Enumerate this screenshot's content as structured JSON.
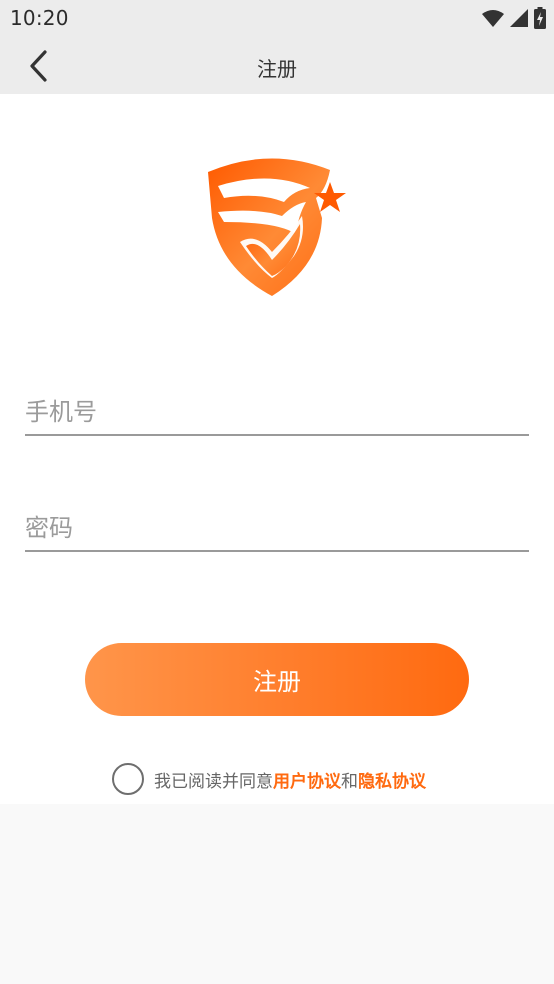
{
  "status_bar": {
    "time": "10:20",
    "icons": [
      "wifi-icon",
      "cellular-signal-icon",
      "battery-charging-icon"
    ]
  },
  "app_bar": {
    "title": "注册",
    "back_icon": "chevron-left-icon"
  },
  "logo": {
    "icon": "shield-star-logo",
    "color": "#ff7a1f"
  },
  "form": {
    "phone": {
      "value": "",
      "placeholder": "手机号"
    },
    "password": {
      "value": "",
      "placeholder": "密码"
    },
    "submit_label": "注册"
  },
  "agreement": {
    "prefix": "我已阅读并同意",
    "user_agreement": "用户协议",
    "conjunction": "和",
    "privacy_policy": "隐私协议",
    "checked": false
  },
  "colors": {
    "accent": "#ff6a10",
    "button_gradient_start": "#ff954a",
    "button_gradient_end": "#ff6a10",
    "bar_background": "#ececec"
  }
}
